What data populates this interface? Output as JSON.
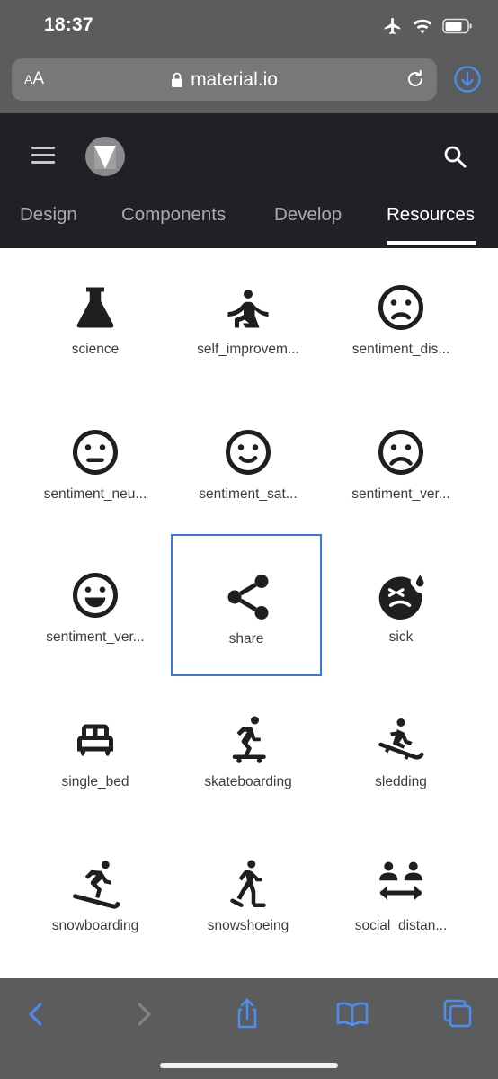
{
  "status_bar": {
    "time": "18:37",
    "icons": [
      "airplane-icon",
      "wifi-icon",
      "battery-icon"
    ]
  },
  "url_bar": {
    "text_size_label_small": "A",
    "text_size_label_large": "A",
    "url": "material.io",
    "lock_icon": "lock-icon",
    "reload_icon": "reload-icon",
    "download_icon": "download-icon"
  },
  "header": {
    "menu_icon": "hamburger-menu-icon",
    "logo_icon": "material-logo-icon",
    "search_icon": "search-icon",
    "tabs": [
      {
        "label": "Design",
        "active": false
      },
      {
        "label": "Components",
        "active": false
      },
      {
        "label": "Develop",
        "active": false
      },
      {
        "label": "Resources",
        "active": true
      }
    ]
  },
  "icons": [
    {
      "label": "science",
      "icon": "science-icon"
    },
    {
      "label": "self_improvem...",
      "icon": "self-improvement-icon"
    },
    {
      "label": "sentiment_dis...",
      "icon": "sentiment-dissatisfied-icon"
    },
    {
      "label": "sentiment_neu...",
      "icon": "sentiment-neutral-icon"
    },
    {
      "label": "sentiment_sat...",
      "icon": "sentiment-satisfied-icon"
    },
    {
      "label": "sentiment_ver...",
      "icon": "sentiment-very-dissatisfied-icon"
    },
    {
      "label": "sentiment_ver...",
      "icon": "sentiment-very-satisfied-icon"
    },
    {
      "label": "share",
      "icon": "share-icon",
      "selected": true
    },
    {
      "label": "sick",
      "icon": "sick-icon"
    },
    {
      "label": "single_bed",
      "icon": "single-bed-icon"
    },
    {
      "label": "skateboarding",
      "icon": "skateboarding-icon"
    },
    {
      "label": "sledding",
      "icon": "sledding-icon"
    },
    {
      "label": "snowboarding",
      "icon": "snowboarding-icon"
    },
    {
      "label": "snowshoeing",
      "icon": "snowshoeing-icon"
    },
    {
      "label": "social_distan...",
      "icon": "social-distance-icon"
    }
  ],
  "toolbar": {
    "icons": [
      "back-icon",
      "forward-icon",
      "share-sheet-icon",
      "bookmarks-icon",
      "tabs-icon"
    ]
  },
  "colors": {
    "chrome": "#5c5c5e",
    "header": "#202124",
    "accent": "#4a8ff7",
    "selection": "#3b78e7"
  }
}
